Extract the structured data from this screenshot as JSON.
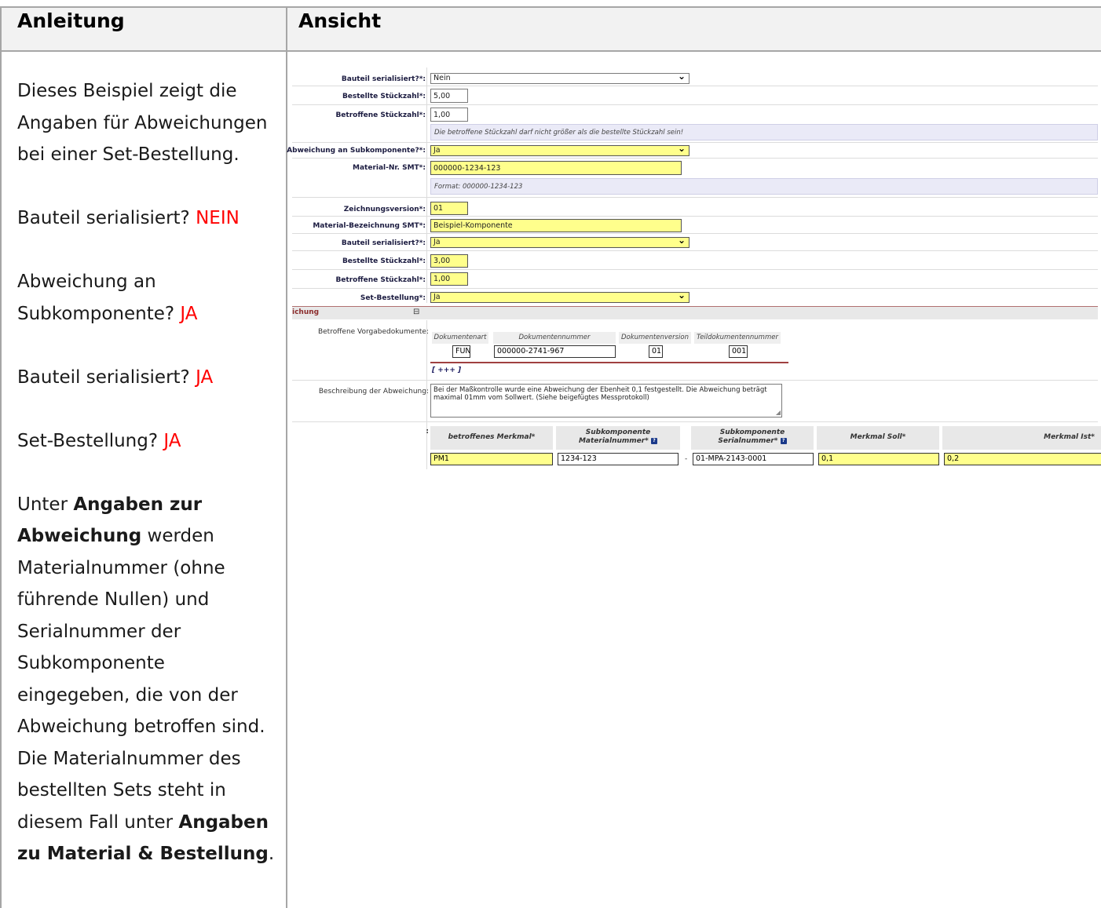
{
  "headers": {
    "left": "Anleitung",
    "right": "Ansicht"
  },
  "instructions": {
    "intro": "Dieses Beispiel zeigt die Angaben für Abweichungen bei einer Set-Bestellung.",
    "q1_label": "Bauteil serialisiert?",
    "q1_answer": "NEIN",
    "q2_label": "Abweichung an Subkomponente?",
    "q2_answer": "JA",
    "q3_label": "Bauteil serialisiert?",
    "q3_answer": "JA",
    "q4_label": "Set-Bestellung?",
    "q4_answer": "JA",
    "para_1": "Unter ",
    "para_bold_1": "Angaben zur Abweichung",
    "para_2": " werden Materialnummer (ohne führende Nullen) und Serialnummer der Subkomponente eingegeben, die von der Abweichung betroffen sind. Die Materialnummer des bestellten Sets steht in diesem Fall unter ",
    "para_bold_2": "Angaben zu Material & Bestellung",
    "para_3": "."
  },
  "form": {
    "rows": [
      {
        "label": "Bauteil serialisiert?*:",
        "value": "Nein"
      },
      {
        "label": "Bestellte Stückzahl*:",
        "value": "5,00"
      },
      {
        "label": "Betroffene Stückzahl*:",
        "value": "1,00"
      },
      {
        "label": "Abweichung an Subkomponente?*:",
        "value": "Ja"
      },
      {
        "label": "Material-Nr. SMT*:",
        "value": "000000-1234-123"
      },
      {
        "label": "Zeichnungsversion*:",
        "value": "01"
      },
      {
        "label": "Material-Bezeichnung SMT*:",
        "value": "Beispiel-Komponente"
      },
      {
        "label": "Bauteil serialisiert?*:",
        "value": "Ja"
      },
      {
        "label": "Bestellte Stückzahl*:",
        "value": "3,00"
      },
      {
        "label": "Betroffene Stückzahl*:",
        "value": "1,00"
      },
      {
        "label": "Set-Bestellung*:",
        "value": "Ja"
      }
    ],
    "hint_quantity": "Die betroffene Stückzahl darf nicht größer als die bestellte Stückzahl sein!",
    "hint_format": "Format: 000000-1234-123",
    "section_title": "ichung",
    "section_toggle": "⊟",
    "docs_label": "Betroffene Vorgabedokumente:",
    "doc_headers": [
      "Dokumentenart",
      "Dokumentennummer",
      "Dokumentenversion",
      "Teildokumentennummer"
    ],
    "doc_values": [
      "FUN",
      "000000-2741-967",
      "01",
      "001"
    ],
    "add_link": "[ +++ ]",
    "desc_label": "Beschreibung der Abweichung:",
    "desc_value": "Bei der Maßkontrolle wurde eine Abweichung der Ebenheit 0,1 festgestellt. Die Abweichung beträgt maximal 01mm vom Sollwert. (Siehe beigefügtes Messprotokoll)",
    "grid_label": ":",
    "grid_headers": {
      "merkmal": "betroffenes Merkmal*",
      "mat_line1": "Subkomponente",
      "mat_line2": "Materialnummer*",
      "ser_line1": "Subkomponente",
      "ser_line2": "Serialnummer*",
      "soll": "Merkmal Soll*",
      "ist": "Merkmal Ist*"
    },
    "grid_values": {
      "merkmal": "PM1",
      "mat": "1234-123",
      "dash": "-",
      "ser": "01-MPA-2143-0001",
      "soll": "0,1",
      "ist": "0,2"
    },
    "help_icon": "?"
  }
}
